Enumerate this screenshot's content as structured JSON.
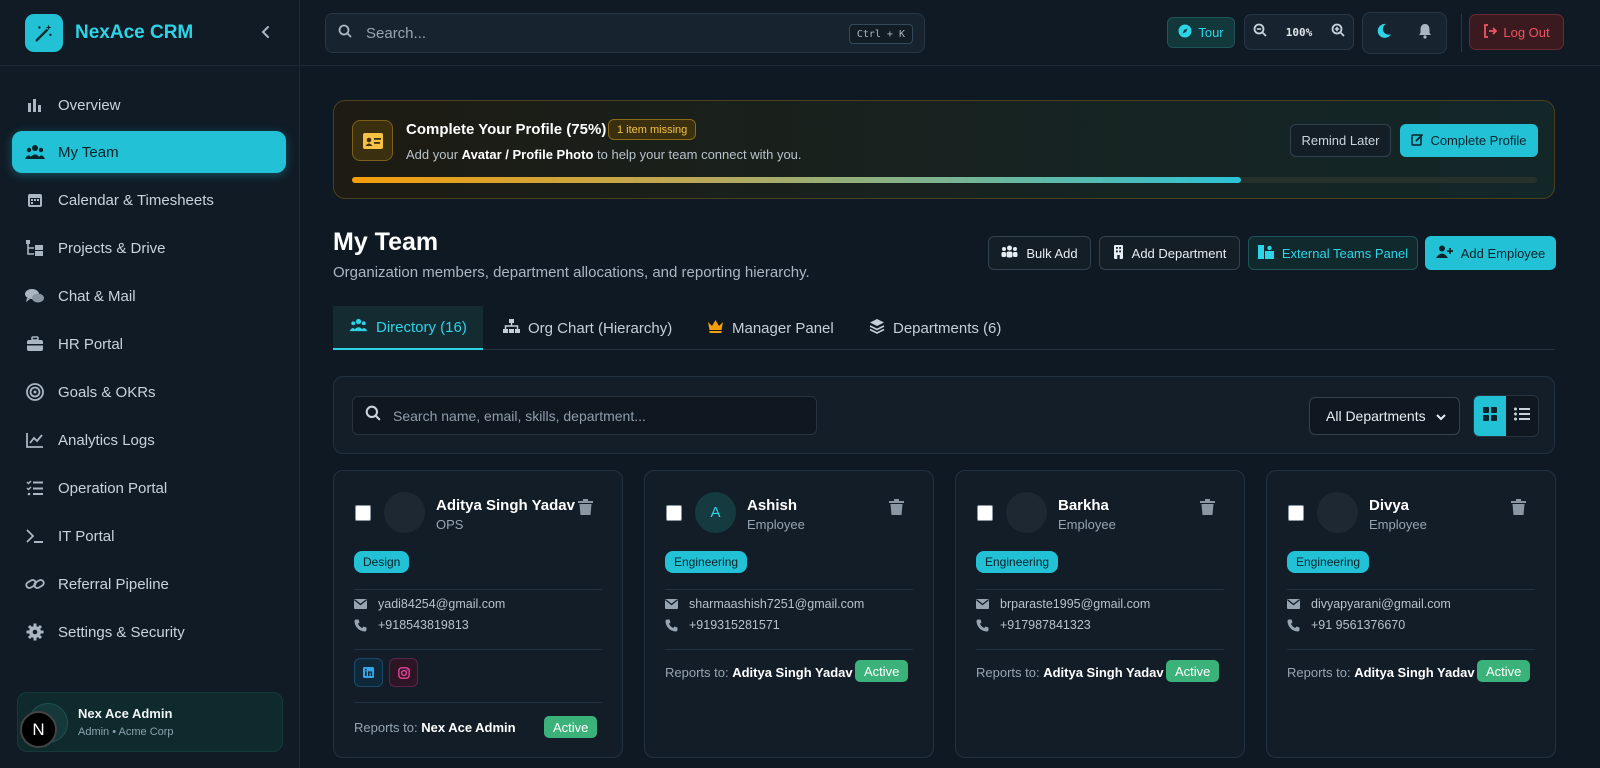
{
  "app": {
    "name": "NexAce CRM"
  },
  "sidebar": {
    "items": [
      {
        "label": "Overview",
        "icon": "chart-bar-icon"
      },
      {
        "label": "My Team",
        "icon": "users-icon"
      },
      {
        "label": "Calendar & Timesheets",
        "icon": "calendar-icon"
      },
      {
        "label": "Projects & Drive",
        "icon": "folder-tree-icon"
      },
      {
        "label": "Chat & Mail",
        "icon": "chat-icon"
      },
      {
        "label": "HR Portal",
        "icon": "briefcase-icon"
      },
      {
        "label": "Goals & OKRs",
        "icon": "target-icon"
      },
      {
        "label": "Analytics Logs",
        "icon": "line-chart-icon"
      },
      {
        "label": "Operation Portal",
        "icon": "list-check-icon"
      },
      {
        "label": "IT Portal",
        "icon": "terminal-icon"
      },
      {
        "label": "Referral Pipeline",
        "icon": "link-icon"
      },
      {
        "label": "Settings & Security",
        "icon": "gear-icon"
      }
    ],
    "active": "My Team",
    "user": {
      "name": "Nex Ace Admin",
      "role": "Admin • Acme Corp",
      "initial": "N"
    }
  },
  "topbar": {
    "search_placeholder": "Search...",
    "shortcut": "Ctrl + K",
    "tour_label": "Tour",
    "zoom": "100%",
    "logout_label": "Log Out"
  },
  "profile_banner": {
    "title": "Complete Your Profile (75%)",
    "badge": "1 item missing",
    "sub_prefix": "Add your",
    "sub_bold": "Avatar / Profile Photo",
    "sub_suffix": "to help your team connect with you.",
    "progress_percent": 75,
    "remind_label": "Remind Later",
    "complete_label": "Complete Profile"
  },
  "page": {
    "title": "My Team",
    "subtitle": "Organization members, department allocations, and reporting hierarchy.",
    "actions": {
      "bulk_add": "Bulk Add",
      "add_department": "Add Department",
      "external_teams": "External Teams Panel",
      "add_employee": "Add Employee"
    }
  },
  "tabs": [
    {
      "label": "Directory (16)",
      "active": true
    },
    {
      "label": "Org Chart (Hierarchy)",
      "active": false
    },
    {
      "label": "Manager Panel",
      "active": false
    },
    {
      "label": "Departments (6)",
      "active": false
    }
  ],
  "filter": {
    "search_placeholder": "Search name, email, skills, department...",
    "department": "All Departments"
  },
  "colors": {
    "accent": "#22c1d6",
    "active_status": "#3bb27a",
    "warning": "#f5c243",
    "danger": "#f05563"
  },
  "employees": [
    {
      "name": "Aditya Singh Yadav",
      "role": "OPS",
      "department": "Design",
      "email": "yadi84254@gmail.com",
      "phone": "+918543819813",
      "reports_label": "Reports to:",
      "reports_to": "Nex Ace Admin",
      "status": "Active",
      "avatar_letter": ""
    },
    {
      "name": "Ashish",
      "role": "Employee",
      "department": "Engineering",
      "email": "sharmaashish7251@gmail.com",
      "phone": "+919315281571",
      "reports_label": "Reports to:",
      "reports_to": "Aditya Singh Yadav",
      "status": "Active",
      "avatar_letter": "A"
    },
    {
      "name": "Barkha",
      "role": "Employee",
      "department": "Engineering",
      "email": "brparaste1995@gmail.com",
      "phone": "+917987841323",
      "reports_label": "Reports to:",
      "reports_to": "Aditya Singh Yadav",
      "status": "Active",
      "avatar_letter": ""
    },
    {
      "name": "Divya",
      "role": "Employee",
      "department": "Engineering",
      "email": "divyapyarani@gmail.com",
      "phone": "+91 9561376670",
      "reports_label": "Reports to:",
      "reports_to": "Aditya Singh Yadav",
      "status": "Active",
      "avatar_letter": ""
    }
  ]
}
